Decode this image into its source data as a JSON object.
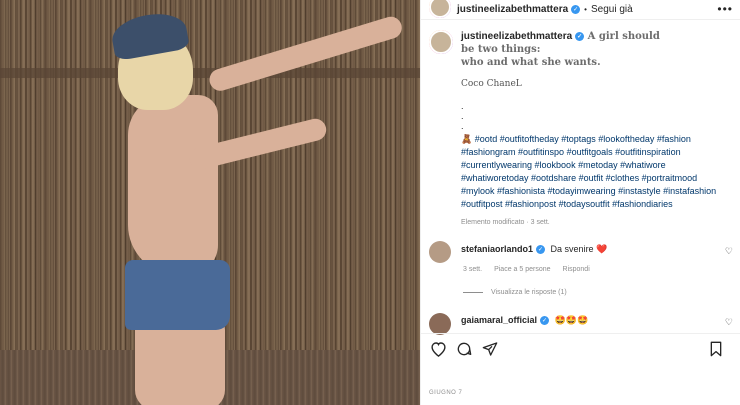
{
  "post": {
    "username": "justineelizabethmattera",
    "follow_label": "Segui già",
    "more_icon": "more-icon",
    "caption_title_1": "A girl should",
    "caption_title_2": "be two things:",
    "caption_title_3": "who and what she wants.",
    "quote_author": "Coco ChaneL",
    "bullets": [
      ".",
      ".",
      "."
    ],
    "hashtags": "🧸 #ootd #outfitoftheday #toptags #lookoftheday #fashion #fashiongram #outfitinspo #outfitgoals #outfitinspiration #currentlywearing #lookbook #metoday #whatiwore #whatiworetoday #ootdshare #outfit #clothes #portraitmood #mylook #fashionista #todayimwearing #instastyle #instafashion #outfitpost #fashionpost #todaysoutfit #fashiondiaries",
    "edited_label": "Elemento modificato · 3 sett.",
    "date": "GIUGNO 7"
  },
  "comments": [
    {
      "username": "stefaniaorlando1",
      "text": "Da svenire ❤️",
      "time": "3 sett.",
      "likes": "Piace a 5 persone",
      "reply": "Rispondi",
      "view_replies": "Visualizza le risposte (1)"
    },
    {
      "username": "gaiamaral_official",
      "text": "🤩🤩🤩"
    }
  ],
  "icons": {
    "like": "heart-icon",
    "comment": "comment-icon",
    "share": "share-icon",
    "save": "bookmark-icon",
    "verified": "verified-badge-icon"
  },
  "colors": {
    "link": "#00376b",
    "verified": "#3897f0",
    "meta_gray": "#8e8e8e"
  }
}
